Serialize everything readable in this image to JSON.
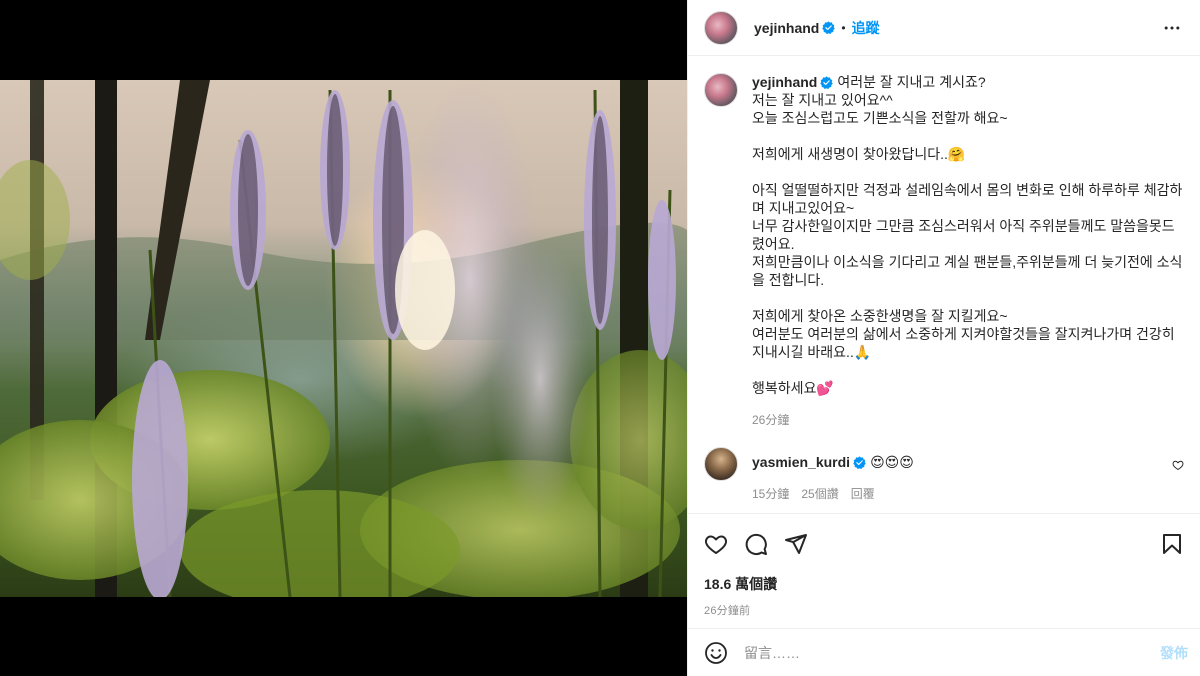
{
  "author": {
    "username": "yejinhand",
    "follow_label": "追蹤",
    "separator": "•"
  },
  "caption": {
    "text": "여러분 잘 지내고 계시죠?\n저는 잘 지내고 있어요^^\n오늘 조심스럽고도 기쁜소식을 전할까 해요~\n\n저희에게 새생명이 찾아왔답니다..🤗\n\n아직 얼떨떨하지만 걱정과 설레임속에서 몸의 변화로 인해 하루하루 체감하며 지내고있어요~\n너무 감사한일이지만 그만큼 조심스러워서 아직 주위분들께도 말씀을못드렸어요.\n저희만큼이나 이소식을 기다리고 계실 팬분들,주위분들께 더 늦기전에 소식을 전합니다.\n\n저희에게 찾아온 소중한생명을 잘 지킬게요~\n여러분도 여러분의 삶에서 소중하게 지켜야할것들을 잘지켜나가며 건강히 지내시길 바래요..🙏\n\n행복하세요💕",
    "time": "26分鐘"
  },
  "comments": [
    {
      "username": "yasmien_kurdi",
      "text": "😍😍😍",
      "time": "15分鐘",
      "likes": "25個讚",
      "reply": "回覆"
    }
  ],
  "stats": {
    "views": "18.6 萬個讚",
    "posted": "26分鐘前"
  },
  "comment_box": {
    "placeholder": "留言……",
    "post_label": "發佈"
  },
  "icons": {
    "more": "more-horizontal-icon",
    "like": "heart-icon",
    "comment": "comment-bubble-icon",
    "share": "paper-plane-icon",
    "save": "bookmark-icon",
    "emoji": "emoji-smile-icon",
    "verified": "verified-badge-icon"
  },
  "colors": {
    "accent": "#0095f6",
    "verified": "#0095f6",
    "muted": "#8e8e8e",
    "post_disabled": "#b2dffc"
  }
}
